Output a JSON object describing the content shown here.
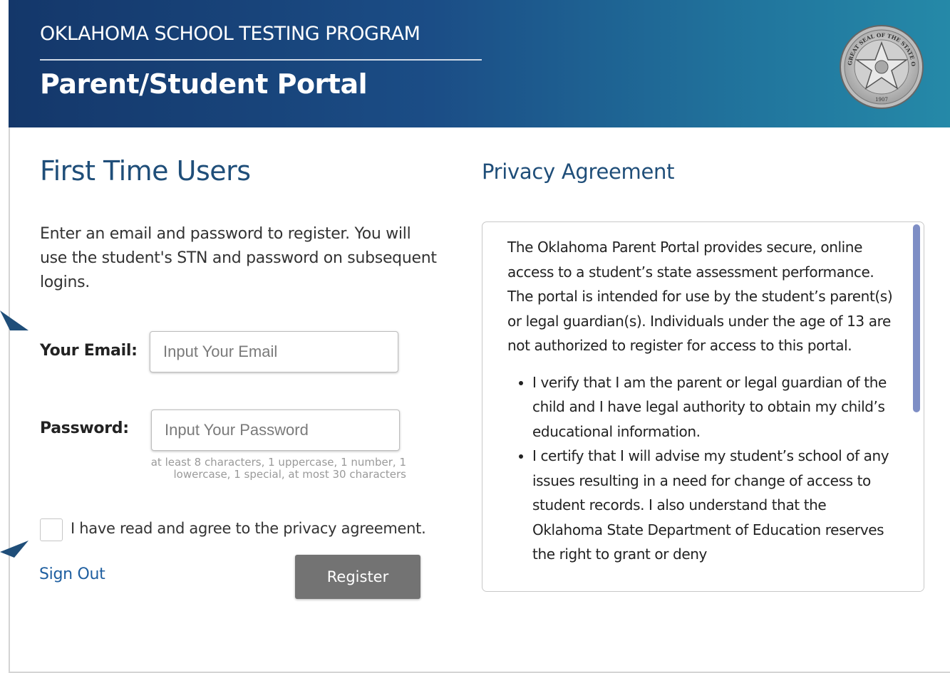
{
  "header": {
    "program": "OKLAHOMA SCHOOL TESTING PROGRAM",
    "portal": "Parent/Student Portal",
    "seal_text_top": "GREAT SEAL OF THE STATE OF OKLAHOMA",
    "seal_year": "1907",
    "gradient_start": "#14376a",
    "gradient_end": "#2589a8"
  },
  "left": {
    "title": "First Time Users",
    "intro": "Enter an email and password to register. You will use the student's STN and password on subsequent logins.",
    "email_label": "Your Email:",
    "email_placeholder": "Input Your Email",
    "email_value": "",
    "password_label": "Password:",
    "password_placeholder": "Input Your Password",
    "password_value": "",
    "password_hint": "at least 8 characters, 1 uppercase, 1 number, 1 lowercase, 1 special, at most 30 characters",
    "agree_label": "I have read and agree to the privacy agreement.",
    "agree_checked": false,
    "signout_label": "Sign Out",
    "register_label": "Register"
  },
  "privacy": {
    "title": "Privacy Agreement",
    "paragraph": "The Oklahoma Parent Portal provides secure, online access to a student’s state assessment performance. The portal is intended for use by the student’s parent(s) or legal guardian(s). Individuals under the age of 13 are not authorized to register for access to this portal.",
    "bullets": [
      "I verify that I am the parent or legal guardian of the child and I have legal authority to obtain my child’s educational information.",
      "I certify that I will advise my student’s school of any issues resulting in a need for change of access to student records. I also understand that the Oklahoma State Department of Education reserves the right to grant or deny"
    ]
  },
  "colors": {
    "accent_blue": "#1f4e79",
    "link_blue": "#1f5fa0",
    "button_gray": "#737373",
    "scroll_thumb": "#7e8ec5"
  }
}
